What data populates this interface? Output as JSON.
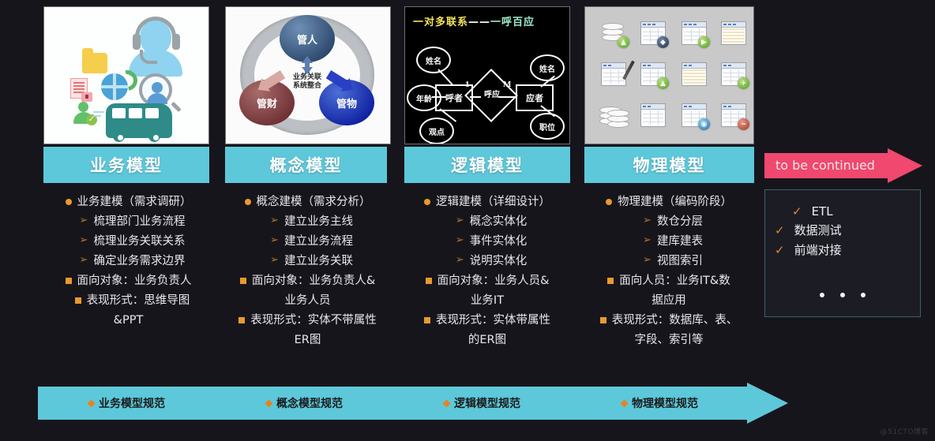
{
  "background_color": "#17151c",
  "accent_color": "#5dc8da",
  "bullet_color": "#e89a2e",
  "cta_color": "#f0486e",
  "cards": [
    {
      "id": "business-model",
      "header": "业务模型",
      "image_kind": "icon-collage",
      "image_caption": "",
      "bullets": [
        {
          "marker": "dot",
          "text": "业务建模（需求调研）"
        },
        {
          "marker": "arrow",
          "text": "梳理部门业务流程"
        },
        {
          "marker": "arrow",
          "text": "梳理业务关联关系"
        },
        {
          "marker": "arrow",
          "text": "确定业务需求边界"
        },
        {
          "marker": "square",
          "text": "面向对象：业务负责人"
        },
        {
          "marker": "square",
          "text": "表现形式：思维导图"
        },
        {
          "marker": "none",
          "text": "&PPT"
        }
      ]
    },
    {
      "id": "concept-model",
      "header": "概念模型",
      "image_kind": "three-circle-diagram",
      "diagram": {
        "top_node": "管人",
        "left_node": "管财",
        "right_node": "管物",
        "center_line1": "业务关联",
        "center_line2": "系统整合"
      },
      "bullets": [
        {
          "marker": "dot",
          "text": "概念建模（需求分析）"
        },
        {
          "marker": "arrow",
          "text": "建立业务主线"
        },
        {
          "marker": "arrow",
          "text": "建立业务流程"
        },
        {
          "marker": "arrow",
          "text": "建立业务关联"
        },
        {
          "marker": "square",
          "text": "面向对象：业务负责人&"
        },
        {
          "marker": "none",
          "text": "业务人员"
        },
        {
          "marker": "square",
          "text": "表现形式：实体不带属性"
        },
        {
          "marker": "none",
          "text": "ER图"
        }
      ]
    },
    {
      "id": "logic-model",
      "header": "逻辑模型",
      "image_kind": "er-diagram",
      "er": {
        "title_part1": "一对多联系",
        "title_dash": "——",
        "title_part2": "一呼百应",
        "left_entity": "呼者",
        "right_entity": "应者",
        "relation": "呼应",
        "left_cardinality": "1",
        "right_cardinality": "M",
        "left_attributes": [
          "姓名",
          "年龄",
          "观点"
        ],
        "right_attributes": [
          "姓名",
          "职位"
        ]
      },
      "bullets": [
        {
          "marker": "dot",
          "text": "逻辑建模（详细设计）"
        },
        {
          "marker": "arrow",
          "text": "概念实体化"
        },
        {
          "marker": "arrow",
          "text": "事件实体化"
        },
        {
          "marker": "arrow",
          "text": "说明实体化"
        },
        {
          "marker": "square",
          "text": "面向对象：业务人员&"
        },
        {
          "marker": "none",
          "text": "业务IT"
        },
        {
          "marker": "square",
          "text": "表现形式：实体带属性"
        },
        {
          "marker": "none",
          "text": "的ER图"
        }
      ]
    },
    {
      "id": "physical-model",
      "header": "物理模型",
      "image_kind": "database-icon-grid",
      "bullets": [
        {
          "marker": "dot",
          "text": "物理建模（编码阶段）"
        },
        {
          "marker": "arrow",
          "text": "数仓分层"
        },
        {
          "marker": "arrow",
          "text": "建库建表"
        },
        {
          "marker": "arrow",
          "text": "视图索引"
        },
        {
          "marker": "square",
          "text": "面向人员：业务IT&数"
        },
        {
          "marker": "none",
          "text": "据应用"
        },
        {
          "marker": "square",
          "text": "表现形式：数据库、表、"
        },
        {
          "marker": "none",
          "text": "字段、索引等"
        }
      ]
    }
  ],
  "to_be_continued": {
    "label": "to be continued",
    "items": [
      {
        "check": "✓",
        "text": "ETL"
      },
      {
        "check": "✓",
        "text": "数据测试"
      },
      {
        "check": "✓",
        "text": "前端对接"
      }
    ],
    "more_indicator": "•••"
  },
  "bottom_banner": {
    "items": [
      "业务模型规范",
      "概念模型规范",
      "逻辑模型规范",
      "物理模型规范"
    ]
  },
  "watermark": "@51CTO博客"
}
